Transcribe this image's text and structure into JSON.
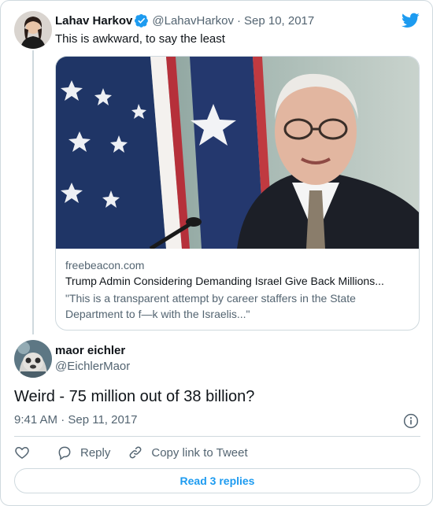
{
  "parent_tweet": {
    "author_name": "Lahav Harkov",
    "author_handle": "@LahavHarkov",
    "separator": "·",
    "date": "Sep 10, 2017",
    "text": "This is awkward, to say the least",
    "card": {
      "domain": "freebeacon.com",
      "title": "Trump Admin Considering Demanding Israel Give Back Millions...",
      "description": "\"This is a transparent attempt by career staffers in the State Department to f—k with the Israelis...\""
    }
  },
  "tweet": {
    "author_name": "maor eichler",
    "author_handle": "@EichlerMaor",
    "text": "Weird - 75 million out of 38 billion?",
    "timestamp": "9:41 AM · Sep 11, 2017"
  },
  "actions": {
    "reply_label": "Reply",
    "copy_link_label": "Copy link to Tweet"
  },
  "read_replies_label": "Read 3 replies",
  "icons": {
    "verified": "verified-badge-icon",
    "brand": "twitter-bird-icon",
    "like": "heart-icon",
    "reply": "speech-bubble-icon",
    "copy_link": "link-icon",
    "info": "info-icon"
  },
  "colors": {
    "brand_blue": "#1d9bf0",
    "text_primary": "#0f1419",
    "text_secondary": "#536471",
    "border": "#cfd9de"
  }
}
